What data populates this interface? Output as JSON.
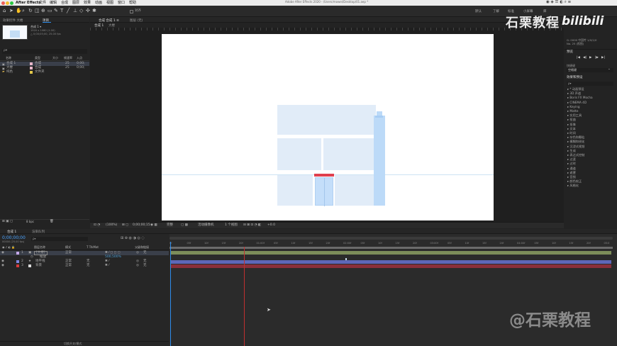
{
  "app": {
    "name": "After Effects",
    "window_title": "Adobe After Effects 2020 - /Users/mowei/Desktop/01.aep *"
  },
  "menu": [
    "文件",
    "编辑",
    "合成",
    "图层",
    "效果",
    "动画",
    "视图",
    "窗口",
    "帮助"
  ],
  "workspaces": [
    "默认",
    "了解",
    "标准",
    "小屏幕",
    "库"
  ],
  "toolbar": {
    "snap_label": "对齐"
  },
  "project_panel": {
    "tab_label": "项目",
    "effect_controls_label": "效果控件 大楼",
    "comp_name": "合成 1 ▾",
    "comp_info1": "1920 x 1080 (1.00)",
    "comp_info2": "△ 0;00;05;00, 25.00 fps",
    "search_placeholder": "ρ▾",
    "columns": [
      "名称",
      "类型",
      "大小",
      "帧速率",
      "入点"
    ],
    "items": [
      {
        "name": "合成 1",
        "type": "合成",
        "rate": "25",
        "in": "0;00;",
        "color": "#e7b6c8"
      },
      {
        "name": "大楼",
        "type": "合成",
        "rate": "25",
        "in": "0;00;",
        "color": "#e7b6c8"
      },
      {
        "name": "纯色",
        "type": "文件夹",
        "rate": "",
        "in": "",
        "color": "#e3c84a"
      }
    ],
    "bpc": "8 bpc"
  },
  "comp_panel": {
    "tab_label": "合成 合成 1 ≡",
    "sub_tabs": [
      "合成 1",
      "大楼"
    ],
    "layer_tab": "图层 (无)",
    "footer": {
      "zoom": "(100%)",
      "timecode": "0;00;00;15",
      "quality": "完整",
      "camera": "活动摄像机",
      "views": "1 个视图",
      "exposure": "+0.0"
    },
    "building_colors": {
      "wall": "#e1ecf8",
      "pillar": "#bcdaf8",
      "awning": "#e0404e",
      "door": "#c4defa",
      "ground": "#cde3f3"
    }
  },
  "right_panel": {
    "info_lines": [
      "G: 0000 中国传 1/0/1/0",
      "No. 25 (视图)"
    ],
    "preview_title": "预览",
    "preview_controls": [
      "|◀",
      "◀|",
      "▶",
      "|▶",
      "▶|"
    ],
    "shortcut_label": "快捷键",
    "shortcut_value": "空格键",
    "effects_title": "效果和预设",
    "effects_search_placeholder": "ρ▾",
    "effects": [
      "* 动画预设",
      "3D 声道",
      "Boris FX Mocha",
      "CINEMA 4D",
      "Keying",
      "Matte",
      "实用工具",
      "扭曲",
      "抠像",
      "文本",
      "时间",
      "杂色和颗粒",
      "模糊和锐化",
      "沉浸式视频",
      "生成",
      "表达式控制",
      "过渡",
      "过时",
      "通道",
      "遮罩",
      "音频",
      "颜色校正",
      "风格化"
    ]
  },
  "timeline": {
    "tabs": [
      "合成 1",
      "渲染队列"
    ],
    "timecode": "0;00;00;00",
    "timecode_sub": "00000 (25.00 fps)",
    "search_placeholder": "ρ▾",
    "columns": [
      "图层名称",
      "模式",
      "T TrkMat",
      "父级和链接"
    ],
    "layers": [
      {
        "index": "1",
        "name": "[大楼]",
        "mode": "正常",
        "trk": "",
        "parent": "无",
        "color": "#c5a8e8"
      },
      {
        "index": "",
        "name": "缩放",
        "mode": "",
        "trk": "",
        "parent": "",
        "color": "#4ca0d8",
        "prop_value": "500,500%"
      },
      {
        "index": "2",
        "name": "地平线",
        "mode": "正常",
        "trk": "无",
        "parent": "无",
        "color": "#7d86e0"
      },
      {
        "index": "3",
        "name": "背景",
        "mode": "正常",
        "trk": "无",
        "parent": "无",
        "color": "#d83a3a"
      }
    ],
    "ruler_labels": [
      "0f",
      "05f",
      "10f",
      "15f",
      "20f",
      "01:00f",
      "05f",
      "10f",
      "15f",
      "20f",
      "02:00f",
      "05f",
      "10f",
      "15f",
      "20f",
      "03:00f",
      "05f",
      "10f",
      "15f",
      "20f",
      "04:00f",
      "05f",
      "10f",
      "15f",
      "20f",
      "05:0"
    ],
    "footer_label": "切换开关/模式"
  },
  "watermark": {
    "top": "石栗教程",
    "brand": "bilibili",
    "bottom": "@石栗教程"
  }
}
